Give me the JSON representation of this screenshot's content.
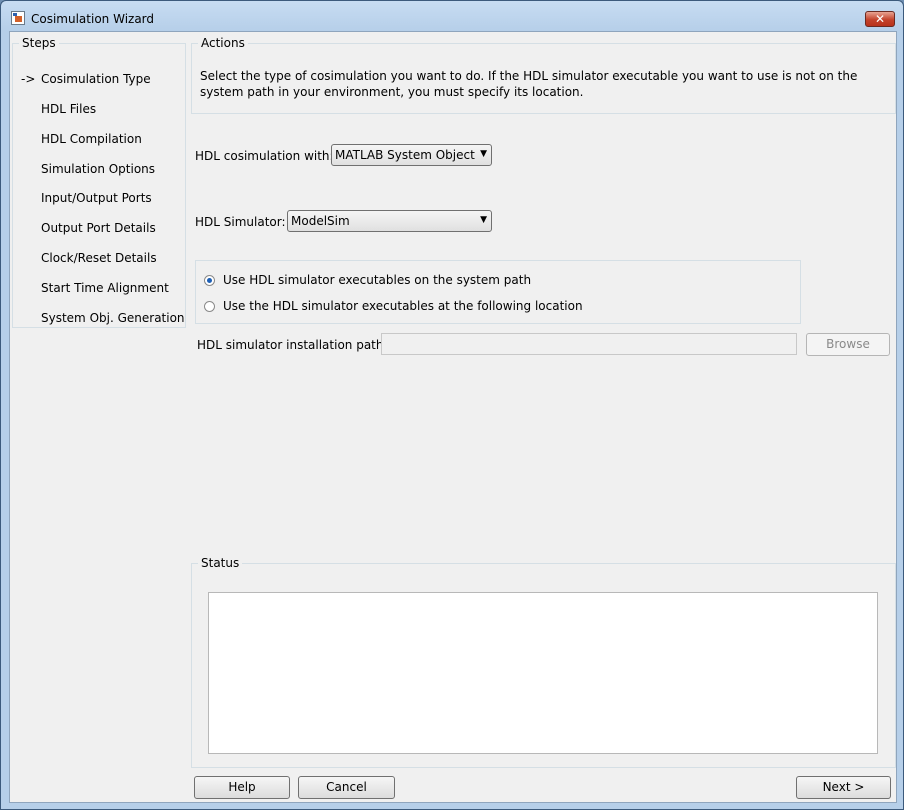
{
  "window": {
    "title": "Cosimulation Wizard",
    "close_glyph": "✕"
  },
  "steps": {
    "legend": "Steps",
    "current_marker": "->",
    "items": [
      "Cosimulation Type",
      "HDL Files",
      "HDL Compilation",
      "Simulation Options",
      "Input/Output Ports",
      "Output Port Details",
      "Clock/Reset Details",
      "Start Time Alignment",
      "System Obj. Generation"
    ]
  },
  "actions": {
    "legend": "Actions",
    "description": "Select the type of cosimulation you want to do. If the HDL simulator executable you want to use is not on the system path in your environment, you must specify its location."
  },
  "form": {
    "cosim_label": "HDL cosimulation with:",
    "cosim_value": "MATLAB System Object",
    "simulator_label": "HDL Simulator:",
    "simulator_value": "ModelSim",
    "radio_system_path": "Use HDL simulator executables on the system path",
    "radio_location": "Use the HDL simulator executables at the following location",
    "selected_radio": "system_path",
    "install_path_label": "HDL simulator installation path:",
    "install_path_value": "",
    "browse_label": "Browse"
  },
  "status": {
    "legend": "Status",
    "text": ""
  },
  "footer": {
    "help_label": "Help",
    "cancel_label": "Cancel",
    "next_label": "Next >"
  },
  "icons": {
    "dropdown": "chevron-down-icon",
    "app": "simulink-app-icon",
    "close": "close-icon"
  },
  "colors": {
    "title_bar": "#b6cfe9",
    "close_button": "#c4432c",
    "dialog_bg": "#f0f0f0",
    "radio_selected": "#1d5fb5"
  }
}
